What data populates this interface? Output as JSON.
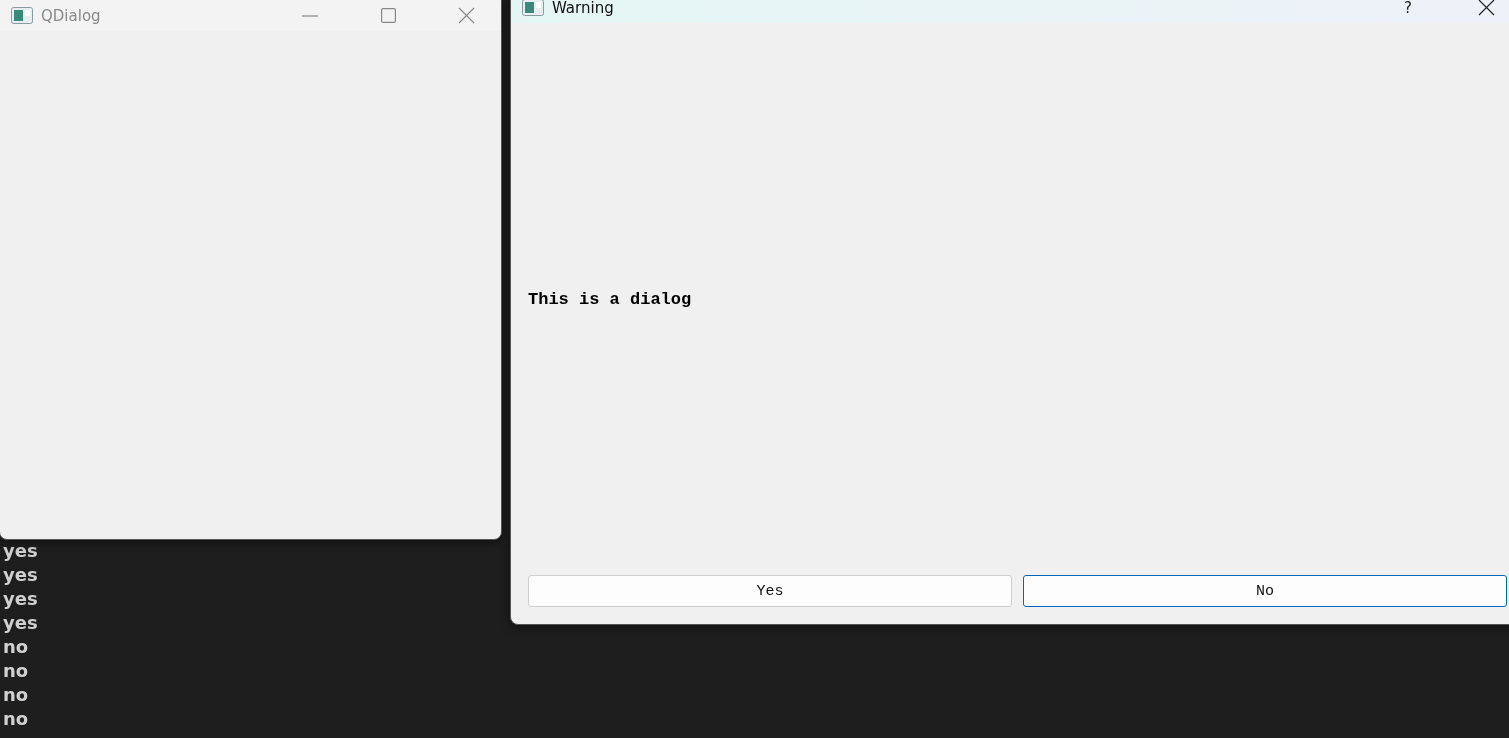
{
  "terminal": {
    "lines": [
      "yes",
      "yes",
      "yes",
      "yes",
      "no",
      "no",
      "no",
      "no"
    ]
  },
  "windows": [
    {
      "kind": "plain",
      "title": "QDialog",
      "active": false
    },
    {
      "kind": "message",
      "title": "Warning",
      "active": true,
      "help_label": "?",
      "message": "This is a dialog",
      "buttons": [
        {
          "label": "Yes",
          "focused": false
        },
        {
          "label": "No",
          "focused": true
        }
      ]
    }
  ]
}
